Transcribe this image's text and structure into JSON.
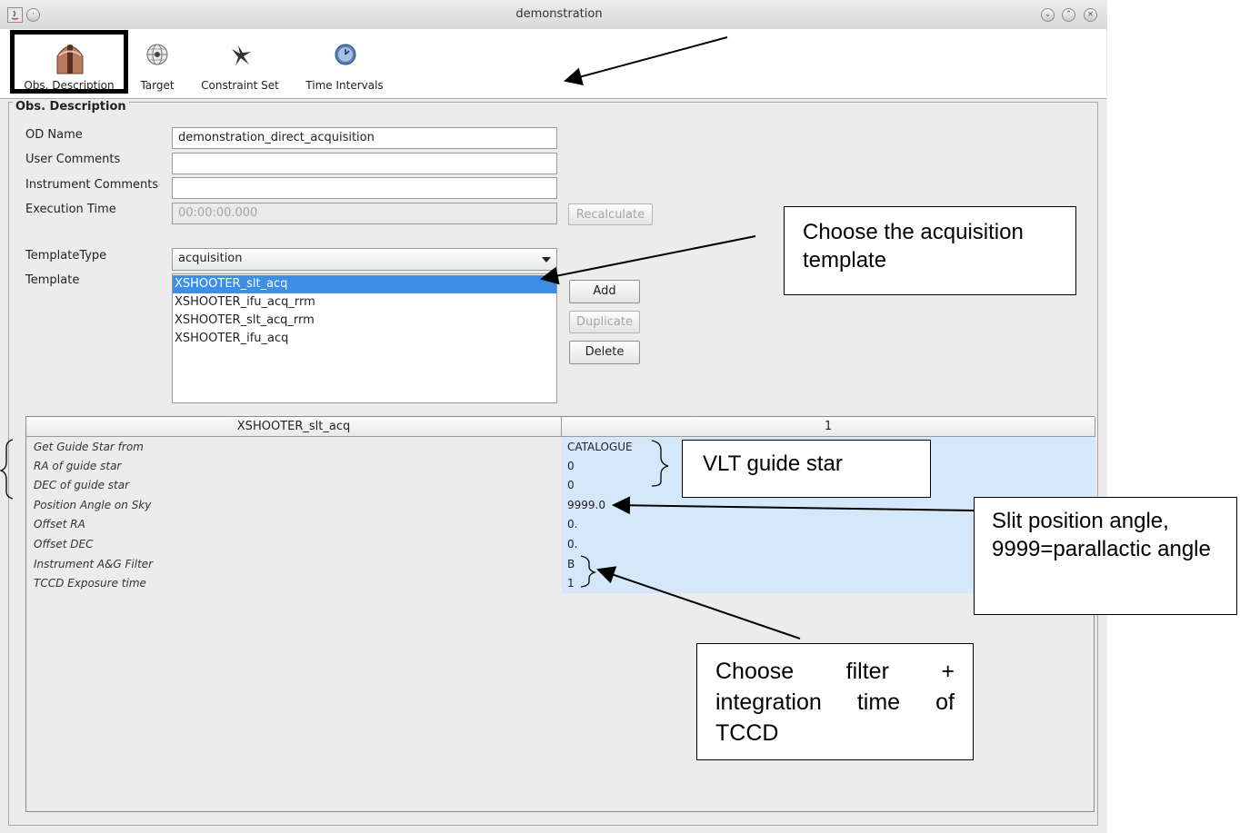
{
  "window": {
    "title": "demonstration"
  },
  "toolbar": {
    "tools": [
      {
        "label": "Obs. Description",
        "icon": "telescope-dome-icon"
      },
      {
        "label": "Target",
        "icon": "globe-icon"
      },
      {
        "label": "Constraint Set",
        "icon": "constraint-icon"
      },
      {
        "label": "Time Intervals",
        "icon": "clock-icon"
      }
    ]
  },
  "panel": {
    "legend": "Obs. Description",
    "od_name_label": "OD Name",
    "od_name_value": "demonstration_direct_acquisition",
    "user_comments_label": "User Comments",
    "user_comments_value": "",
    "instrument_comments_label": "Instrument Comments",
    "instrument_comments_value": "",
    "execution_time_label": "Execution Time",
    "execution_time_value": "00:00:00.000",
    "recalculate_label": "Recalculate",
    "template_type_label": "TemplateType",
    "template_type_value": "acquisition",
    "template_label": "Template",
    "templates": [
      "XSHOOTER_slt_acq",
      "XSHOOTER_ifu_acq_rrm",
      "XSHOOTER_slt_acq_rrm",
      "XSHOOTER_ifu_acq"
    ],
    "selected_template_index": 0,
    "add_label": "Add",
    "duplicate_label": "Duplicate",
    "delete_label": "Delete"
  },
  "param_table": {
    "col_header": "XSHOOTER_slt_acq",
    "value_header": "1",
    "rows": [
      {
        "label": "Get Guide Star from",
        "value": "CATALOGUE"
      },
      {
        "label": "RA of guide star",
        "value": "0"
      },
      {
        "label": "DEC of guide star",
        "value": "0"
      },
      {
        "label": "Position Angle on Sky",
        "value": "9999.0"
      },
      {
        "label": "Offset RA",
        "value": "0."
      },
      {
        "label": "Offset DEC",
        "value": "0."
      },
      {
        "label": "Instrument A&G Filter",
        "value": "B"
      },
      {
        "label": "TCCD Exposure time",
        "value": "1"
      }
    ]
  },
  "annotations": {
    "template": "Choose the acquisition template",
    "guide_star": "VLT guide star",
    "slit_angle": "Slit position angle, 9999=parallactic angle",
    "filter": "Choose filter + integration time of TCCD"
  },
  "colors": {
    "selection": "#3d8fe6",
    "table_value_bg": "#d5e8fb"
  }
}
